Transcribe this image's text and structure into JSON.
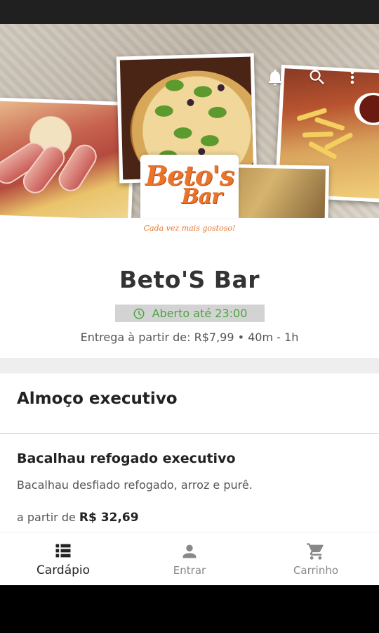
{
  "header": {
    "icons": [
      "bell-icon",
      "search-icon",
      "more-vert-icon"
    ]
  },
  "logo": {
    "word1": "Beto's",
    "word2": "Bar",
    "tagline": "Cada vez mais gostoso!"
  },
  "store": {
    "name": "Beto'S Bar",
    "status": "Aberto até 23:00",
    "status_color": "#4aa53f",
    "delivery": "Entrega à partir de: R$7,99 • 40m - 1h"
  },
  "menu": {
    "section_title": "Almoço executivo",
    "items": [
      {
        "name": "Bacalhau refogado executivo",
        "description": "Bacalhau desfiado refogado, arroz e purê.",
        "price_prefix": "a partir de",
        "price": "R$ 32,69"
      }
    ]
  },
  "bottom_nav": [
    {
      "label": "Cardápio",
      "icon": "menu-list-icon",
      "active": true
    },
    {
      "label": "Entrar",
      "icon": "person-icon",
      "active": false
    },
    {
      "label": "Carrinho",
      "icon": "cart-icon",
      "active": false
    }
  ]
}
